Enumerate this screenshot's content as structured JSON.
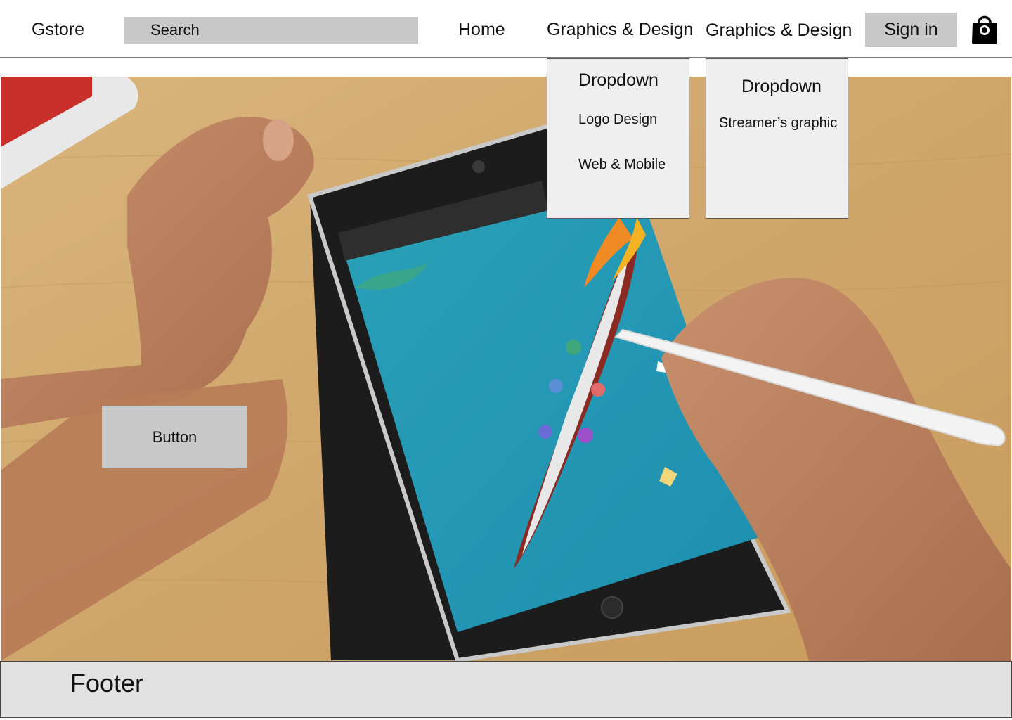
{
  "header": {
    "brand": "Gstore",
    "search_placeholder": "Search",
    "nav": {
      "home": "Home",
      "menu1": "Graphics & Design",
      "menu2": "Graphics & Design"
    },
    "sign_in": "Sign in",
    "cart_icon": "shopping-bag-icon"
  },
  "dropdowns": [
    {
      "title": "Dropdown",
      "items": [
        "Logo Design",
        "Web & Mobile"
      ]
    },
    {
      "title": "Dropdown",
      "items": [
        "Streamer’s graphic"
      ]
    }
  ],
  "hero": {
    "image": "hands drawing a dragon boat illustration on a tablet with a stylus on a wooden desk",
    "button_label": "Button"
  },
  "footer": {
    "label": "Footer"
  }
}
